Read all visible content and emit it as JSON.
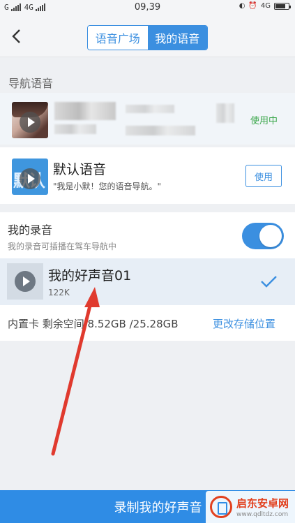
{
  "status_bar": {
    "carrier_left": "G",
    "network_left": "4G",
    "time": "09,39",
    "network_right": "4G"
  },
  "header": {
    "tabs": [
      {
        "label": "语音广场",
        "active": false
      },
      {
        "label": "我的语音",
        "active": true
      }
    ]
  },
  "nav_voice": {
    "section_label": "导航语音",
    "current": {
      "status": "使用中"
    },
    "default": {
      "title": "默认语音",
      "subtitle": "\"我是小默！您的语音导航。\"",
      "thumb_text": "默认",
      "button": "使用"
    }
  },
  "my_recordings": {
    "title": "我的录音",
    "subtitle": "我的录音可插播在驾车导航中",
    "toggle_on": true,
    "items": [
      {
        "name": "我的好声音01",
        "size": "122K",
        "selected": true
      }
    ]
  },
  "storage": {
    "info": "内置卡 剩余空间 8.52GB /25.28GB",
    "change_label": "更改存储位置"
  },
  "bottom": {
    "record_label": "录制我的好声音"
  },
  "watermark": {
    "name": "启东安卓网",
    "url": "www.qdltdz.com"
  },
  "colors": {
    "accent": "#3b8fe0",
    "using_green": "#3aa64a",
    "annotation_red": "#e03a2e"
  }
}
